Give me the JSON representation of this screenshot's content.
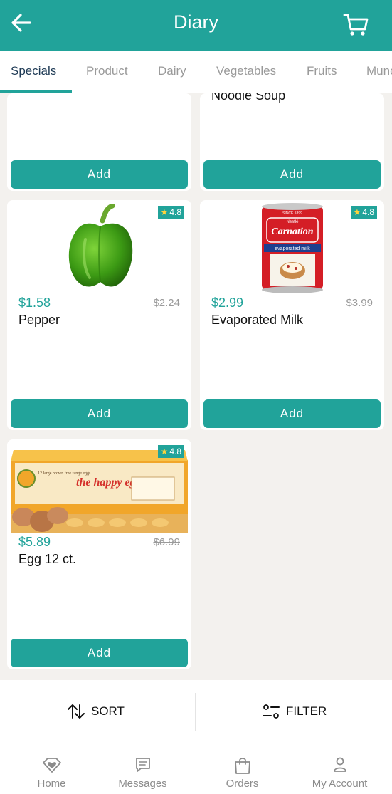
{
  "header": {
    "title": "Diary",
    "back_icon": "back-arrow-icon",
    "cart_icon": "cart-icon"
  },
  "tabs": [
    {
      "label": "Specials",
      "active": true
    },
    {
      "label": "Product"
    },
    {
      "label": "Dairy"
    },
    {
      "label": "Vegetables"
    },
    {
      "label": "Fruits"
    },
    {
      "label": "Munc"
    }
  ],
  "products": [
    {
      "name": "Noodle Soup",
      "add_label": "Add"
    },
    {
      "name": "",
      "add_label": "Add"
    },
    {
      "name": "Pepper",
      "price": "$1.58",
      "old_price": "$2.24",
      "rating": "4.8",
      "add_label": "Add"
    },
    {
      "name": "Evaporated Milk",
      "price": "$2.99",
      "old_price": "$3.99",
      "rating": "4.8",
      "add_label": "Add",
      "can_brand": "Carnation",
      "can_maker": "Nestlé",
      "can_band": "evaporated milk",
      "can_since": "SINCE 1899"
    },
    {
      "name": "Egg 12 ct.",
      "price": "$5.89",
      "old_price": "$6.99",
      "rating": "4.8",
      "add_label": "Add",
      "carton_brand": "the happy egg co.",
      "carton_label": "12 large brown free range eggs"
    }
  ],
  "sortbar": {
    "sort_label": "SORT",
    "filter_label": "FILTER"
  },
  "bottom_nav": [
    {
      "label": "Home",
      "icon": "home-heart-icon"
    },
    {
      "label": "Messages",
      "icon": "message-icon"
    },
    {
      "label": "Orders",
      "icon": "shopping-bag-icon"
    },
    {
      "label": "My Account",
      "icon": "person-icon"
    }
  ],
  "colors": {
    "primary": "#21a39a",
    "star": "#ffd43b",
    "background": "#f3f1ee"
  }
}
